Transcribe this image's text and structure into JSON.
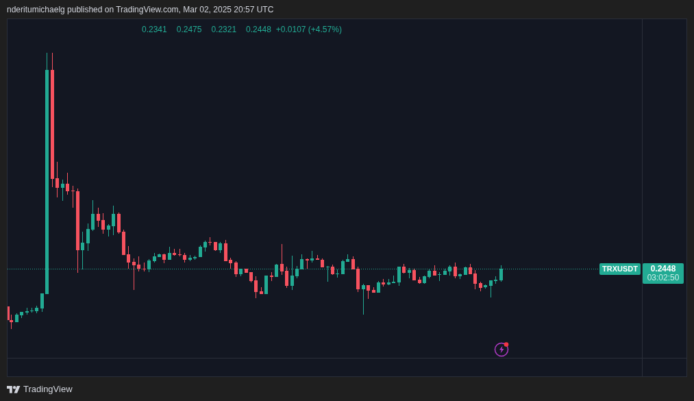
{
  "header": {
    "text": "nderitumichaelg published on TradingView.com, Mar 02, 2025 20:57 UTC"
  },
  "chart": {
    "legend": {
      "values": [
        "0.2341",
        "0.2475",
        "0.2321",
        "0.2448"
      ],
      "change": "+0.0107 (+4.57%)"
    },
    "symbol_label": "TRXUSDT",
    "price_label": {
      "price": "0.2448",
      "countdown": "03:02:50"
    }
  },
  "footer": {
    "brand": "TradingView"
  }
}
